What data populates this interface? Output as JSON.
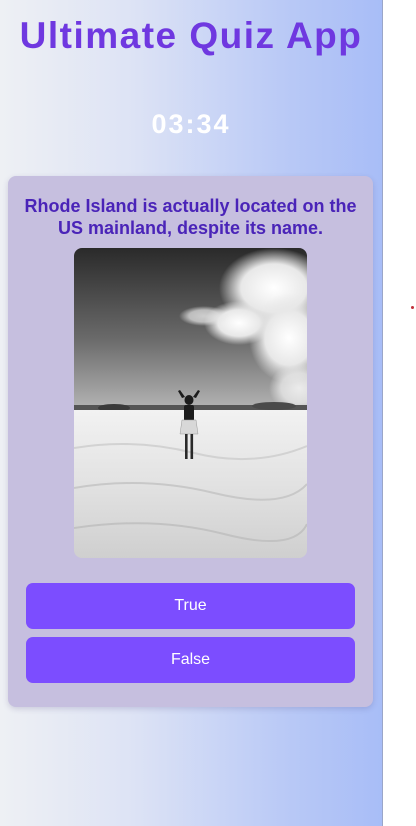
{
  "app": {
    "title": "Ultimate Quiz App",
    "timer": "03:34"
  },
  "quiz": {
    "question": "Rhode Island is actually located on the US mainland, despite its name.",
    "image": {
      "description_icon": "beach-photo-icon",
      "alt": ""
    },
    "options": [
      {
        "label": "True"
      },
      {
        "label": "False"
      }
    ]
  },
  "colors": {
    "title": "#6f38e0",
    "question": "#4a24b8",
    "button": "#7c4dff",
    "card": "#c6bfdf",
    "timer": "#ffffff"
  }
}
